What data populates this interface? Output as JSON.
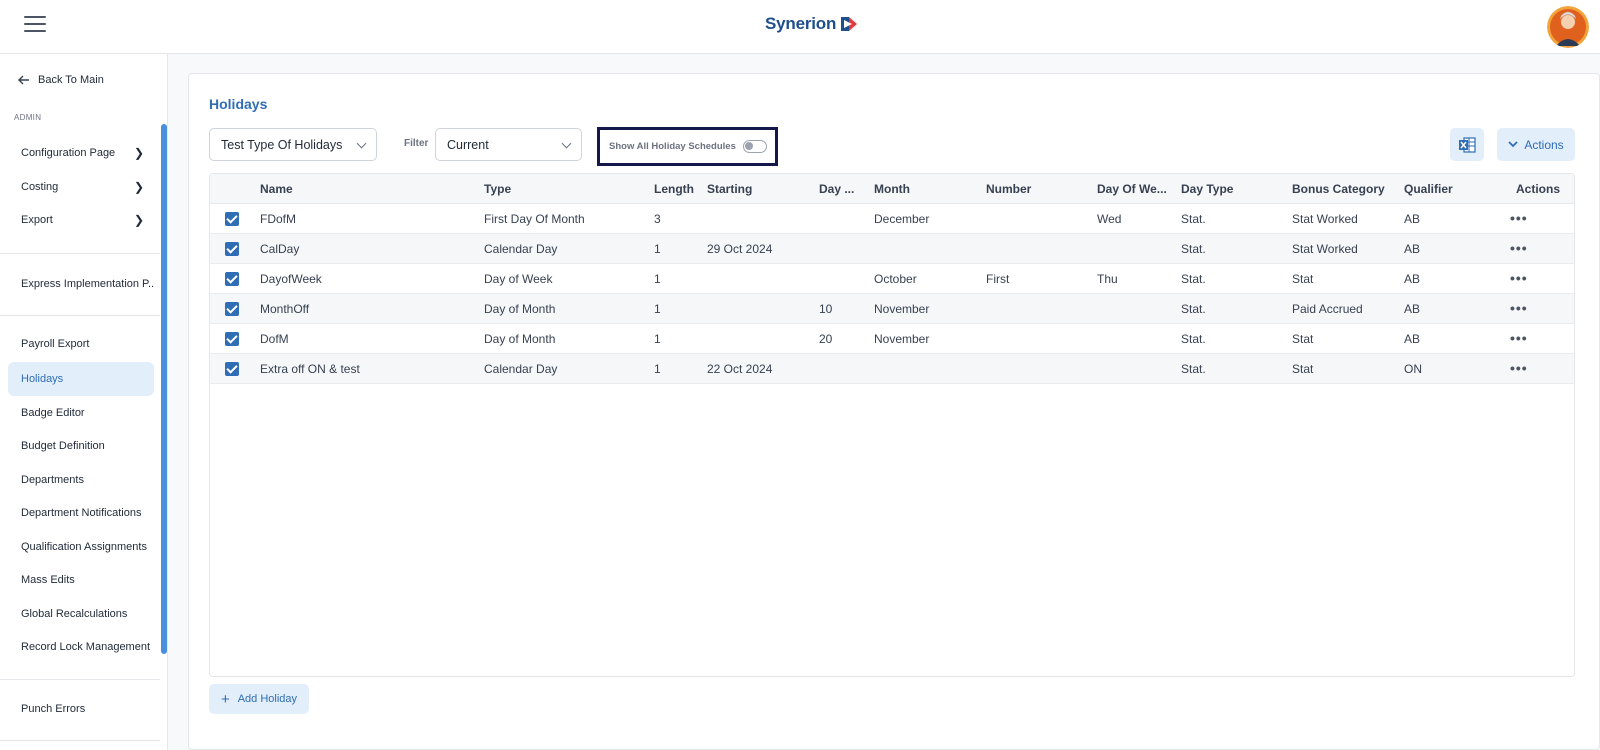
{
  "header": {
    "logo_text": "Synerion",
    "menu_icon": "hamburger-icon",
    "avatar_icon": "user-avatar-icon"
  },
  "sidebar": {
    "back_label": "Back To Main",
    "section_label": "ADMIN",
    "group1": [
      {
        "label": "Configuration Page"
      },
      {
        "label": "Costing"
      },
      {
        "label": "Export"
      }
    ],
    "group2": [
      {
        "label": "Express Implementation P..."
      }
    ],
    "group3": [
      {
        "label": "Payroll Export"
      },
      {
        "label": "Holidays"
      },
      {
        "label": "Badge Editor"
      },
      {
        "label": "Budget Definition"
      },
      {
        "label": "Departments"
      },
      {
        "label": "Department Notifications"
      },
      {
        "label": "Qualification Assignments"
      },
      {
        "label": "Mass Edits"
      },
      {
        "label": "Global Recalculations"
      },
      {
        "label": "Record Lock Management"
      }
    ],
    "group4": [
      {
        "label": "Punch Errors"
      }
    ],
    "active_item": "Holidays"
  },
  "main": {
    "title": "Holidays",
    "type_select": {
      "value": "Test Type Of Holidays"
    },
    "filter": {
      "label": "Filter",
      "value": "Current"
    },
    "toggle": {
      "label": "Show All Holiday Schedules",
      "on": false
    },
    "excel_icon": "excel-export-icon",
    "actions_label": "Actions",
    "add_label": "Add Holiday"
  },
  "table": {
    "columns": [
      "Name",
      "Type",
      "Length",
      "Starting",
      "Day ...",
      "Month",
      "Number",
      "Day Of We...",
      "Day Type",
      "Bonus Category",
      "Qualifier",
      "Actions"
    ],
    "rows": [
      [
        "FDofM",
        "First Day Of Month",
        "3",
        "",
        "",
        "December",
        "",
        "Wed",
        "Stat.",
        "Stat Worked",
        "AB"
      ],
      [
        "CalDay",
        "Calendar Day",
        "1",
        "29 Oct 2024",
        "",
        "",
        "",
        "",
        "Stat.",
        "Stat Worked",
        "AB"
      ],
      [
        "DayofWeek",
        "Day of Week",
        "1",
        "",
        "",
        "October",
        "First",
        "Thu",
        "Stat.",
        "Stat",
        "AB"
      ],
      [
        "MonthOff",
        "Day of Month",
        "1",
        "",
        "10",
        "November",
        "",
        "",
        "Stat.",
        "Paid Accrued",
        "AB"
      ],
      [
        "DofM",
        "Day of Month",
        "1",
        "",
        "20",
        "November",
        "",
        "",
        "Stat.",
        "Stat",
        "AB"
      ],
      [
        "Extra off ON & test",
        "Calendar Day",
        "1",
        "22 Oct 2024",
        "",
        "",
        "",
        "",
        "Stat.",
        "Stat",
        "ON"
      ]
    ],
    "row_action_label": "•••"
  }
}
